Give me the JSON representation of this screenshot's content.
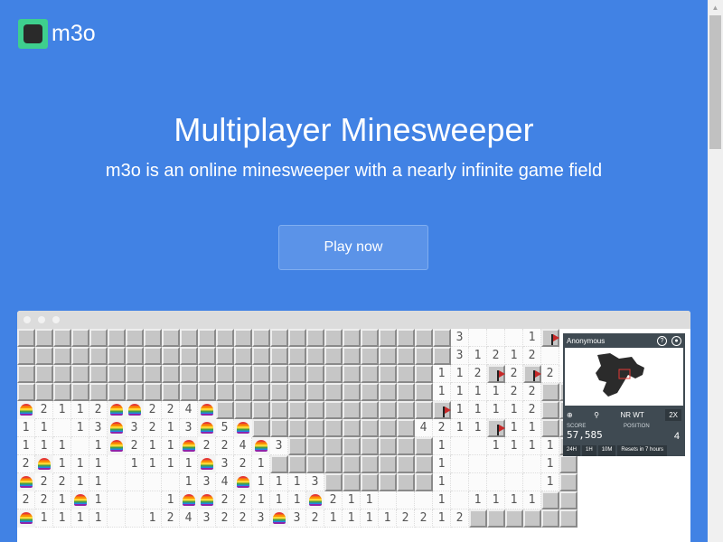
{
  "brand": {
    "name": "m3o",
    "logo_icon": "m3o-logo-icon"
  },
  "hero": {
    "title": "Multiplayer Minesweeper",
    "subtitle": "m3o is an online minesweeper with a nearly infinite game field",
    "cta_label": "Play now"
  },
  "preview": {
    "board_rows": [
      "CCCCCCCCCCCCCCCCCCCCCCCC3...1F",
      "CCCCCCCCCCCCCCCCCCCCCCCC31212.",
      "CCCCCCCCCCCCCCCCCCCCCCC112F2F21",
      "CCCCCCCCCCCCCCCCCCCCCCC111122CC",
      "H2112HH224HCCCCCCCCCCCCF11112CC",
      "11.13H3213H5HCCCCCCCCC4211F11CC",
      "111.1H211H224H3CCCCCCCC1..1111C",
      "2H111.1111H321CCCCCCCCC1.....1C",
      "H2211....134H1113CCCCCC1.....1C",
      "221H1...1HH22111H211...1.1111CC",
      "H1111..1243223H3211112212CCCCCC"
    ],
    "panel": {
      "player": "Anonymous",
      "map_label": "NR WT",
      "zoom": "2X",
      "score_label": "SCORE",
      "score": "57,585",
      "position_label": "POSITION",
      "position": "4",
      "time_filters": [
        "24H",
        "1H",
        "10M"
      ],
      "reset_note": "Resets in 7 hours"
    }
  },
  "colors": {
    "background": "#4182e4",
    "button": "#5b93e8",
    "logo": "#3ecf8e"
  }
}
